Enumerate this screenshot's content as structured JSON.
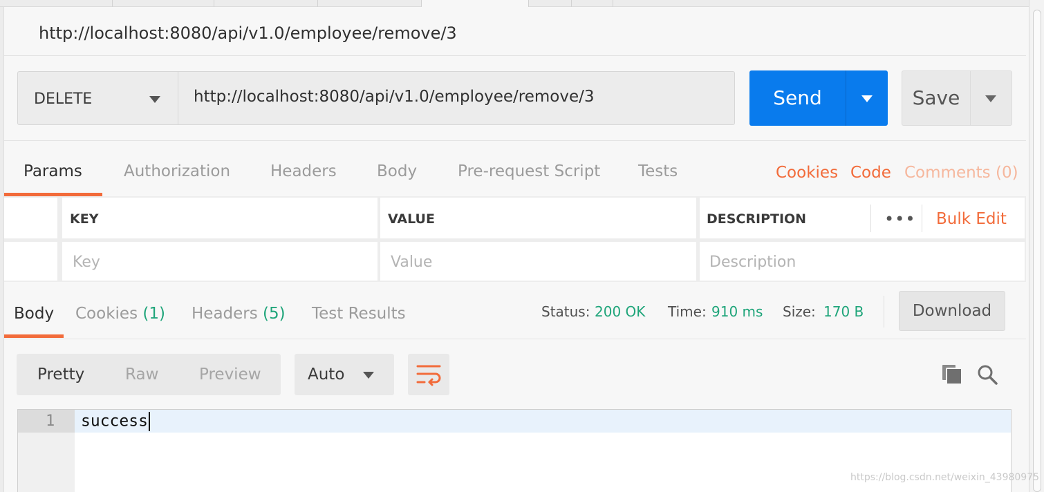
{
  "request": {
    "title": "http://localhost:8080/api/v1.0/employee/remove/3",
    "method": "DELETE",
    "url": "http://localhost:8080/api/v1.0/employee/remove/3",
    "send_label": "Send",
    "save_label": "Save"
  },
  "request_tabs": {
    "params": "Params",
    "authorization": "Authorization",
    "headers": "Headers",
    "body": "Body",
    "pre_request_script": "Pre-request Script",
    "tests": "Tests",
    "active": "Params"
  },
  "request_links": {
    "cookies": "Cookies",
    "code": "Code",
    "comments": "Comments (0)"
  },
  "params_table": {
    "headers": {
      "key": "KEY",
      "value": "VALUE",
      "description": "DESCRIPTION"
    },
    "bulk_edit": "Bulk Edit",
    "more": "•••",
    "placeholders": {
      "key": "Key",
      "value": "Value",
      "description": "Description"
    }
  },
  "response_tabs": {
    "body": "Body",
    "cookies": "Cookies",
    "cookies_count": "(1)",
    "headers": "Headers",
    "headers_count": "(5)",
    "test_results": "Test Results",
    "active": "Body"
  },
  "response_meta": {
    "status_label": "Status:",
    "status_value": "200 OK",
    "time_label": "Time:",
    "time_value": "910 ms",
    "size_label": "Size:",
    "size_value": "170 B",
    "download_label": "Download"
  },
  "view_options": {
    "pretty": "Pretty",
    "raw": "Raw",
    "preview": "Preview",
    "active": "Pretty",
    "format": "Auto"
  },
  "response_body": {
    "line_number": "1",
    "content": "success"
  },
  "watermark": "https://blog.csdn.net/weixin_43980975",
  "colors": {
    "accent_orange": "#f26b3a",
    "send_blue": "#097bed",
    "status_green": "#1fa57a"
  },
  "icons": {
    "method_caret": "chevron-down-icon",
    "send_caret": "chevron-down-icon",
    "save_caret": "chevron-down-icon",
    "wrap": "wrap-lines-icon",
    "copy": "copy-icon",
    "search": "search-icon"
  }
}
